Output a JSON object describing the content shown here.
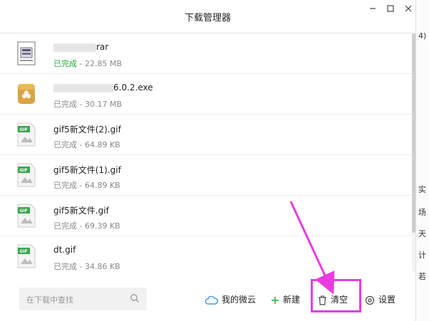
{
  "window": {
    "title": "下载管理器"
  },
  "downloads": [
    {
      "name": "rar",
      "status": "已完成",
      "size": "22.85 MB",
      "type": "rar",
      "status_color": "#21a834"
    },
    {
      "name": "6.0.2.exe",
      "status": "已完成",
      "size": "30.17 MB",
      "type": "exe"
    },
    {
      "name": "gif5新文件(2).gif",
      "status": "已完成",
      "size": "64.89 KB",
      "type": "gif"
    },
    {
      "name": "gif5新文件(1).gif",
      "status": "已完成",
      "size": "64.89 KB",
      "type": "gif"
    },
    {
      "name": "gif5新文件.gif",
      "status": "已完成",
      "size": "69.39 KB",
      "type": "gif"
    },
    {
      "name": "dt.gif",
      "status": "已完成",
      "size": "34.86 KB",
      "type": "gif"
    }
  ],
  "bottom": {
    "search_placeholder": "在下载中查找",
    "weiyun_label": "我的微云",
    "new_label": "新建",
    "clear_label": "清空",
    "settings_label": "设置"
  },
  "right_strip": [
    "4)",
    "实",
    "场",
    "天",
    "计",
    "若"
  ],
  "colors": {
    "accent_green": "#21a834",
    "highlight_magenta": "#e93be0",
    "gif_green": "#3aa64c"
  }
}
